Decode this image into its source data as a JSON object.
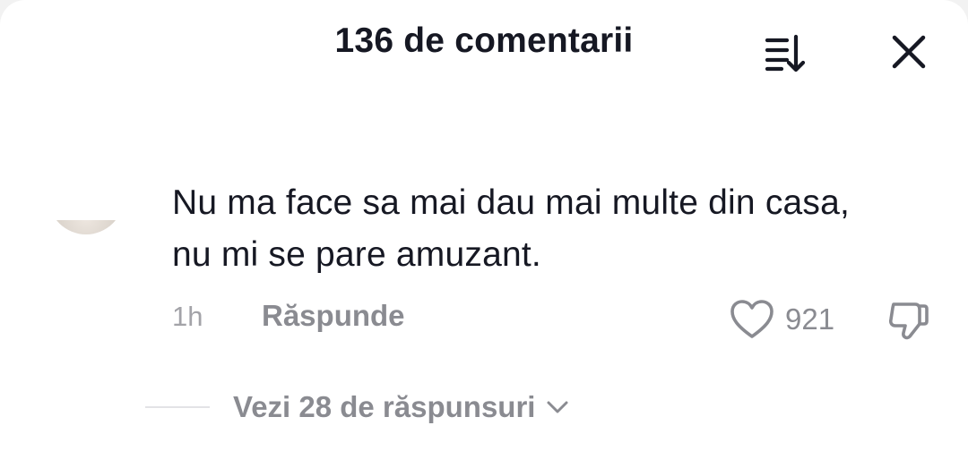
{
  "header": {
    "title": "136 de comentarii",
    "sort_icon": "sort-descending-icon",
    "close_icon": "close-icon"
  },
  "comment": {
    "avatar": "user-avatar",
    "text": "Nu ma face sa mai dau mai multe din casa, nu mi se pare amuzant.",
    "time": "1h",
    "reply_label": "Răspunde",
    "like_icon": "heart-icon",
    "like_count": "921",
    "dislike_icon": "thumbs-down-icon"
  },
  "replies": {
    "label": "Vezi 28 de răspunsuri",
    "icon": "chevron-down-icon"
  },
  "colors": {
    "text_primary": "#161823",
    "text_secondary": "#8a8b91",
    "text_muted": "#a3a3a8",
    "background": "#ffffff"
  }
}
